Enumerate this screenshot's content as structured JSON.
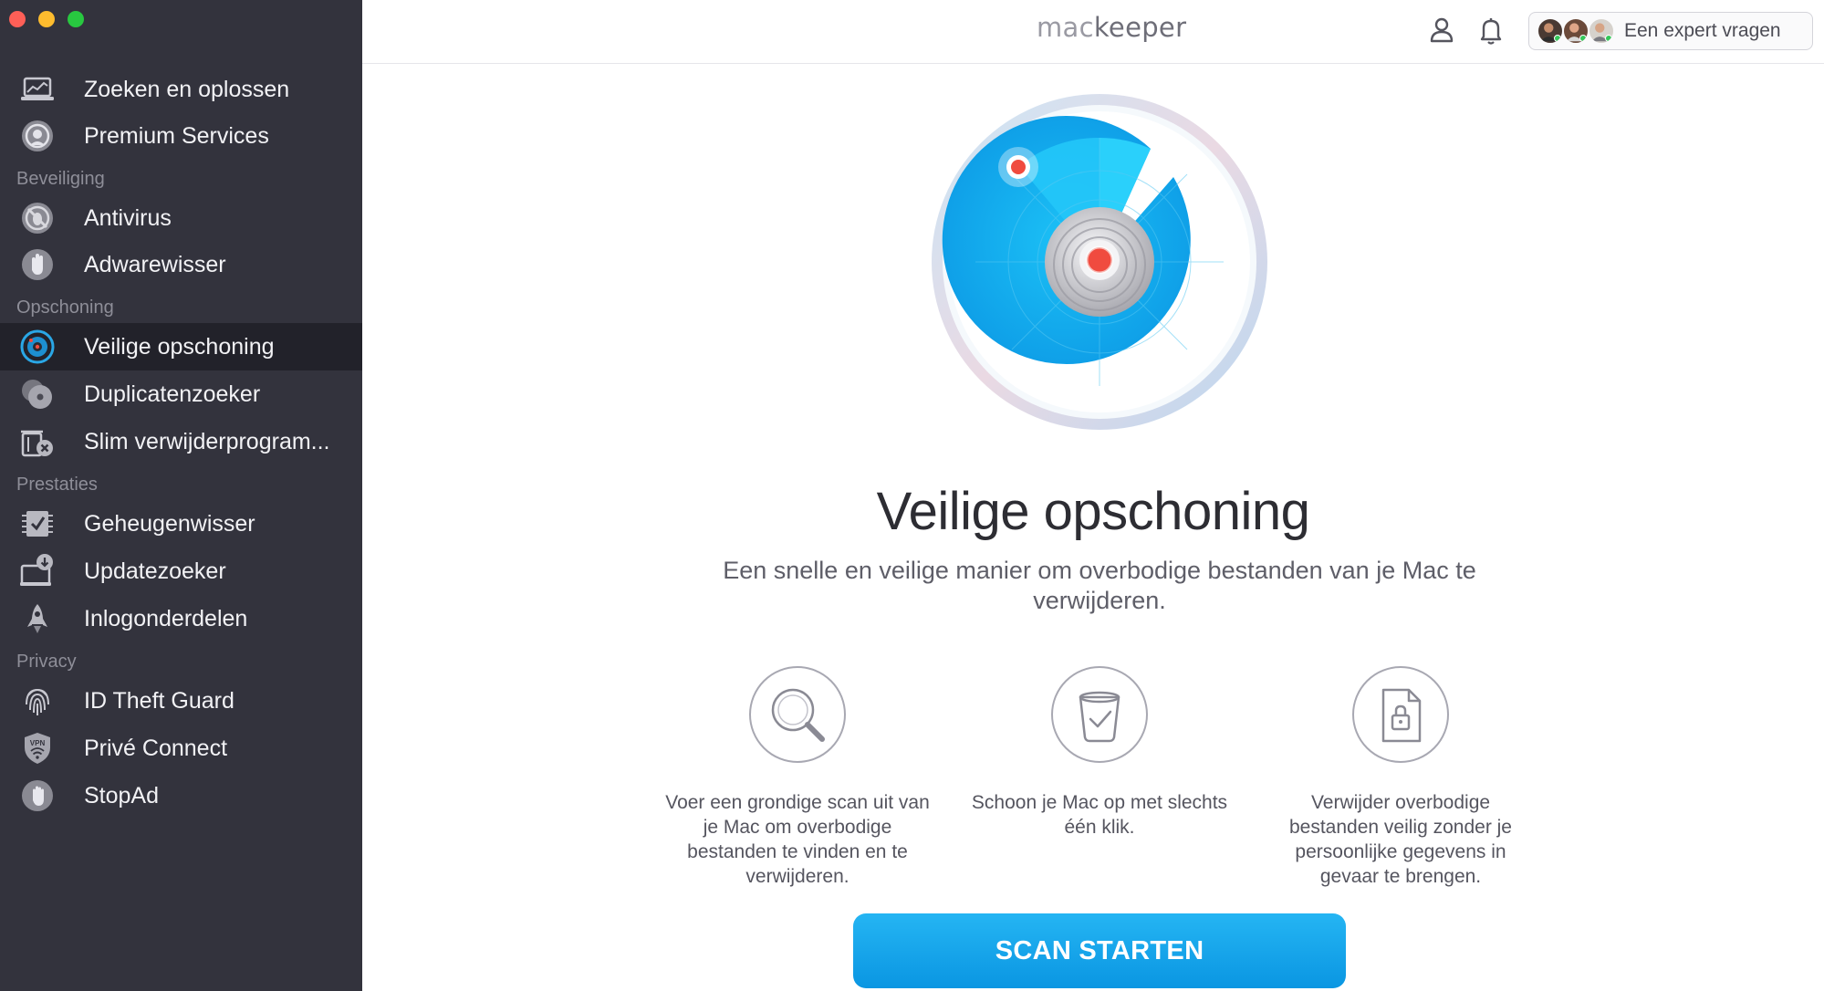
{
  "app": {
    "logo_prefix": "mac",
    "logo_suffix": "keeper"
  },
  "header": {
    "expert_label": "Een expert vragen"
  },
  "sidebar": {
    "items": [
      {
        "label": "Zoeken en oplossen",
        "icon": "laptop-chart-icon"
      },
      {
        "label": "Premium Services",
        "icon": "support-headset-icon"
      },
      {
        "label": "Antivirus",
        "icon": "bug-blocked-icon"
      },
      {
        "label": "Adwarewisser",
        "icon": "hand-stop-icon"
      },
      {
        "label": "Veilige opschoning",
        "icon": "radar-target-icon",
        "active": true
      },
      {
        "label": "Duplicatenzoeker",
        "icon": "duplicate-discs-icon"
      },
      {
        "label": "Slim verwijderprogram...",
        "icon": "trash-uninstall-icon"
      },
      {
        "label": "Geheugenwisser",
        "icon": "memory-check-icon"
      },
      {
        "label": "Updatezoeker",
        "icon": "update-download-icon"
      },
      {
        "label": "Inlogonderdelen",
        "icon": "rocket-icon"
      },
      {
        "label": "ID Theft Guard",
        "icon": "fingerprint-icon"
      },
      {
        "label": "Privé Connect",
        "icon": "vpn-shield-icon"
      },
      {
        "label": "StopAd",
        "icon": "stop-hand-icon"
      }
    ],
    "sections": {
      "security": "Beveiliging",
      "cleaning": "Opschoning",
      "performance": "Prestaties",
      "privacy": "Privacy"
    }
  },
  "main": {
    "title": "Veilige opschoning",
    "subtitle": "Een snelle en veilige manier om overbodige bestanden van je Mac te verwijderen.",
    "features": [
      {
        "icon": "magnifier-icon",
        "text": "Voer een grondige scan uit van je Mac om overbodige bestanden te vinden en te verwijderen."
      },
      {
        "icon": "bin-check-icon",
        "text": "Schoon je Mac op met slechts één klik."
      },
      {
        "icon": "locked-file-icon",
        "text": "Verwijder overbodige bestanden veilig zonder je persoonlijke gegevens in gevaar te brengen."
      }
    ],
    "scan_button": "SCAN STARTEN"
  },
  "colors": {
    "sidebar_bg": "#33333d",
    "sidebar_active": "#22222a",
    "accent": "#14a6ec",
    "radar_red": "#f04b3f"
  }
}
